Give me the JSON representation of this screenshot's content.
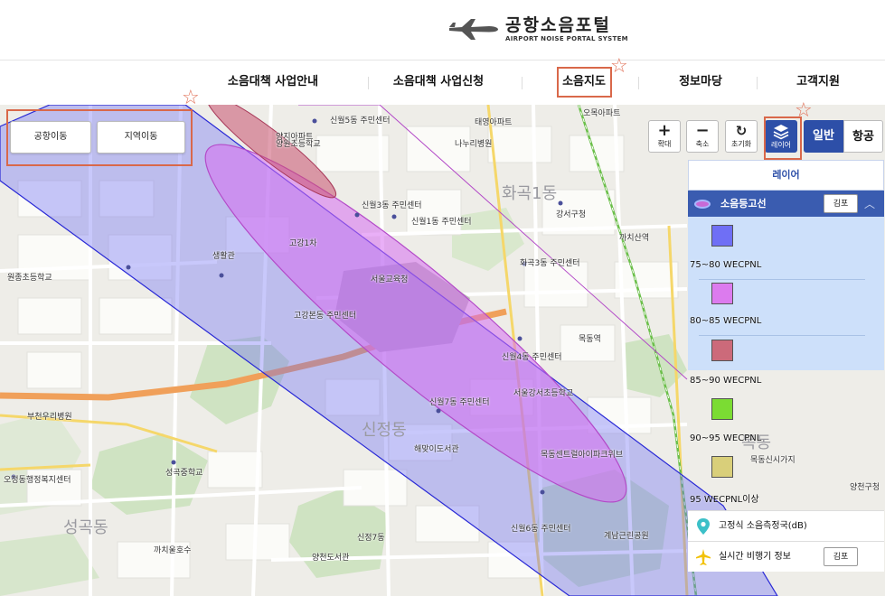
{
  "header": {
    "logo_title": "공항소음포털",
    "logo_subtitle": "AIRPORT NOISE PORTAL SYSTEM"
  },
  "nav": {
    "items": [
      {
        "label": "소음대책 사업안내"
      },
      {
        "label": "소음대책 사업신청"
      },
      {
        "label": "소음지도",
        "active": true
      },
      {
        "label": "정보마당"
      },
      {
        "label": "고객지원"
      }
    ]
  },
  "map_controls": {
    "airport_move": "공항이동",
    "region_move": "지역이동",
    "zoom_in": "확대",
    "zoom_out": "축소",
    "reset": "초기화",
    "layer": "레이어",
    "type_general": "일반",
    "type_aerial": "항공"
  },
  "layer_panel": {
    "title": "레이어",
    "contour_section": "소음등고선",
    "airport_button": "김포",
    "legend": [
      {
        "label": "75~80 WECPNL",
        "color": "#6f6ff5"
      },
      {
        "label": "80~85 WECPNL",
        "color": "#dc7bee"
      },
      {
        "label": "85~90 WECPNL",
        "color": "#cc6a7a"
      },
      {
        "label": "90~95 WECPNL",
        "color": "#7bdc33"
      },
      {
        "label": "95 WECPNL이상",
        "color": "#d9cf7a"
      }
    ],
    "fixed_station": "고정식 소음측정국(dB)",
    "realtime_flight": "실시간 비행기 정보",
    "realtime_airport_button": "김포"
  },
  "map_labels": {
    "items": [
      {
        "text": "신월5동 주민센터"
      },
      {
        "text": "태영아파트"
      },
      {
        "text": "오목아파트"
      },
      {
        "text": "나누리병원"
      },
      {
        "text": "양원초등학교"
      },
      {
        "text": "신월3동 주민센터"
      },
      {
        "text": "신월1동 주민센터"
      },
      {
        "text": "화곡1동"
      },
      {
        "text": "까치산역"
      },
      {
        "text": "화곡3동 주민센터"
      },
      {
        "text": "강서구청"
      },
      {
        "text": "고강1차"
      },
      {
        "text": "생활관"
      },
      {
        "text": "양지아파트"
      },
      {
        "text": "서울교육청"
      },
      {
        "text": "고강본동 주민센터"
      },
      {
        "text": "신월7동 주민센터"
      },
      {
        "text": "신월4동 주민센터"
      },
      {
        "text": "목동역"
      },
      {
        "text": "목동"
      },
      {
        "text": "서울강서초등학교"
      },
      {
        "text": "부천우리병원"
      },
      {
        "text": "원종초등학교"
      },
      {
        "text": "성곡동"
      },
      {
        "text": "성곡중학교"
      },
      {
        "text": "신정동"
      },
      {
        "text": "신월6동 주민센터"
      },
      {
        "text": "양천구청"
      },
      {
        "text": "해맞이도서관"
      },
      {
        "text": "계남근린공원"
      },
      {
        "text": "오정동행정복지센터"
      },
      {
        "text": "까치울호수"
      },
      {
        "text": "신정7동"
      },
      {
        "text": "목동센트럴아이파크위브"
      },
      {
        "text": "목동신시가지"
      },
      {
        "text": "양천도서관"
      }
    ]
  }
}
